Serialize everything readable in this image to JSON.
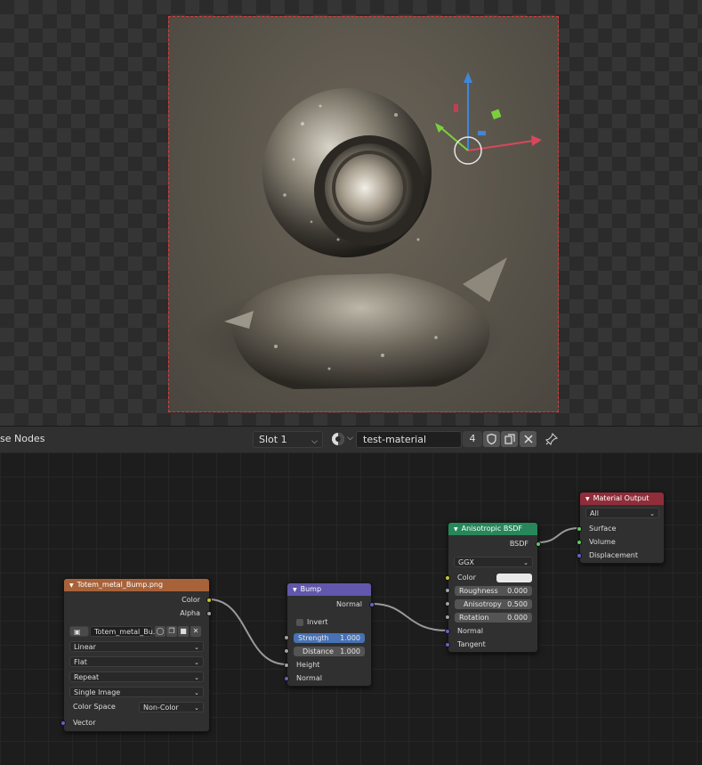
{
  "header": {
    "editor_title": "se Nodes",
    "slot": "Slot 1",
    "material_name": "test-material",
    "user_count": "4"
  },
  "nodes": {
    "image_texture": {
      "title": "Totem_metal_Bump.png",
      "out_color": "Color",
      "out_alpha": "Alpha",
      "image_name": "Totem_metal_Bu...",
      "interpolation": "Linear",
      "projection": "Flat",
      "extension": "Repeat",
      "source": "Single Image",
      "color_space_label": "Color Space",
      "color_space": "Non-Color",
      "in_vector": "Vector"
    },
    "bump": {
      "title": "Bump",
      "out_normal": "Normal",
      "invert": "Invert",
      "strength_label": "Strength",
      "strength": "1.000",
      "distance_label": "Distance",
      "distance": "1.000",
      "in_height": "Height",
      "in_normal": "Normal"
    },
    "anisotropic": {
      "title": "Anisotropic BSDF",
      "out_bsdf": "BSDF",
      "distribution": "GGX",
      "color_label": "Color",
      "roughness_label": "Roughness",
      "roughness": "0.000",
      "anisotropy_label": "Anisotropy",
      "anisotropy": "0.500",
      "rotation_label": "Rotation",
      "rotation": "0.000",
      "in_normal": "Normal",
      "in_tangent": "Tangent"
    },
    "material_output": {
      "title": "Material Output",
      "target": "All",
      "in_surface": "Surface",
      "in_volume": "Volume",
      "in_displacement": "Displacement"
    }
  },
  "colors": {
    "image_header": "#a8623a",
    "bump_header": "#6257ac",
    "shader_header": "#27875a",
    "output_header": "#8f2d3a",
    "socket_color": "#c7c729",
    "socket_float": "#a1a1a1",
    "socket_vector": "#6363c7",
    "socket_shader": "#63c763",
    "field_active": "#4772b3"
  }
}
